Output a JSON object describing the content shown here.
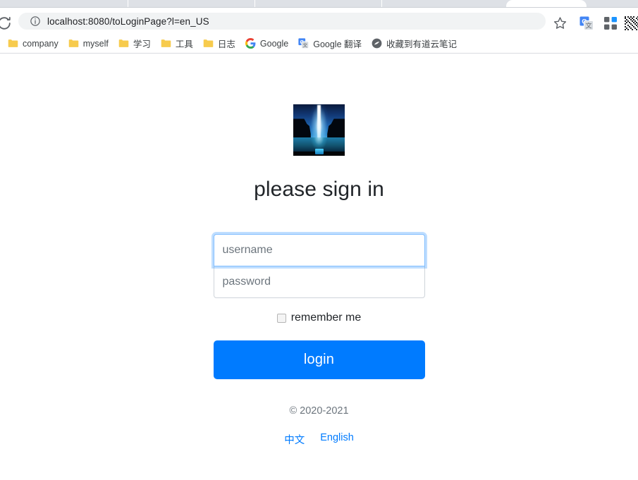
{
  "browser": {
    "reload_icon": "reload-icon",
    "omnibox": {
      "info_icon": "info-circle-icon",
      "url": "localhost:8080/toLoginPage?l=en_US"
    },
    "star_icon": "star-icon",
    "extensions": [
      {
        "name": "google-translate-extension-icon"
      },
      {
        "name": "extensions-puzzle-icon"
      },
      {
        "name": "qr-code-icon"
      }
    ],
    "bookmarks": [
      {
        "label": "company",
        "icon": "folder-icon"
      },
      {
        "label": "myself",
        "icon": "folder-icon"
      },
      {
        "label": "学习",
        "icon": "folder-icon"
      },
      {
        "label": "工具",
        "icon": "folder-icon"
      },
      {
        "label": "日志",
        "icon": "folder-icon"
      },
      {
        "label": "Google",
        "icon": "google-icon"
      },
      {
        "label": "Google 翻译",
        "icon": "google-translate-icon"
      },
      {
        "label": "收藏到有道云笔记",
        "icon": "youdao-note-icon"
      }
    ]
  },
  "login": {
    "logo_alt": "brand-logo",
    "title": "please sign in",
    "username": {
      "value": "",
      "placeholder": "username"
    },
    "password": {
      "value": "",
      "placeholder": "password"
    },
    "remember_label": "remember me",
    "remember_checked": false,
    "login_button": "login",
    "copyright": "© 2020-2021",
    "languages": [
      {
        "label": "中文"
      },
      {
        "label": "English"
      }
    ]
  },
  "colors": {
    "accent": "#007bff",
    "focus_border": "#80bdff",
    "field_border": "#ced4da",
    "muted_text": "#6c757d",
    "chrome_tabstrip": "#dee1e6"
  }
}
